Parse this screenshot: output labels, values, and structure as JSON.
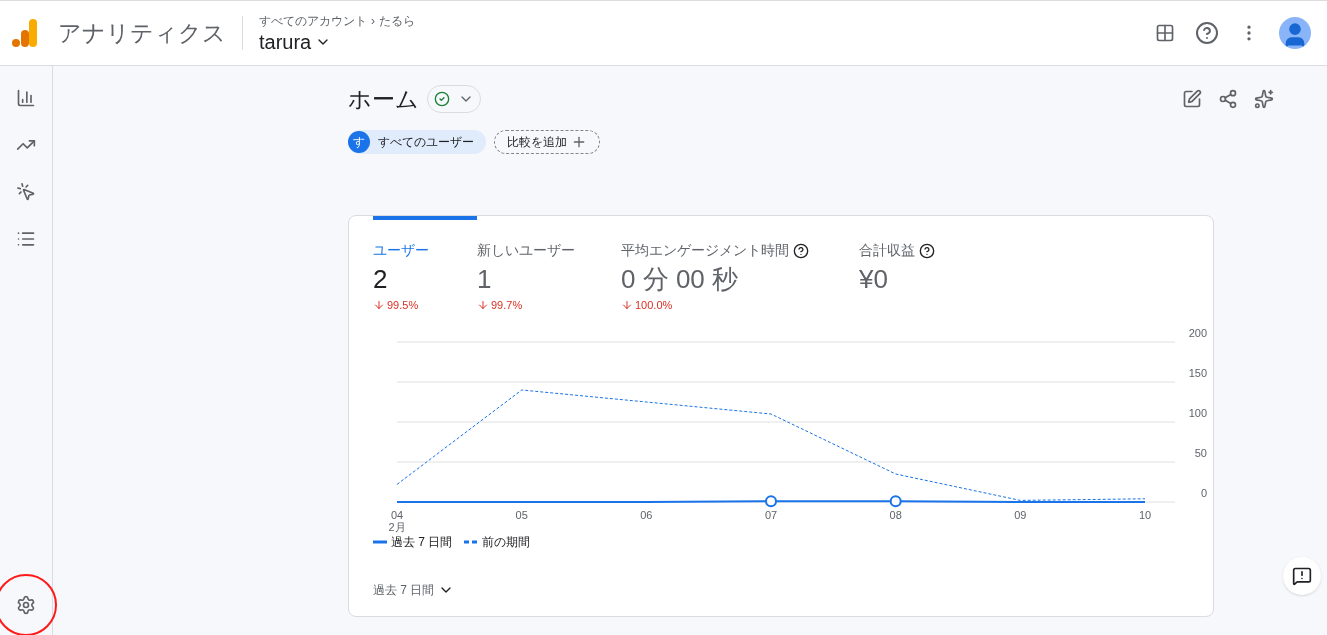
{
  "header": {
    "product": "アナリティクス",
    "breadcrumb": [
      "すべてのアカウント",
      "›",
      "たるら"
    ],
    "property": "tarura"
  },
  "sidebar": {
    "items": [
      {
        "kind": "reports"
      },
      {
        "kind": "explore"
      },
      {
        "kind": "advertising"
      },
      {
        "kind": "configure"
      }
    ],
    "settings_highlighted": true
  },
  "page": {
    "title": "ホーム",
    "verified": true
  },
  "segments": {
    "chip_letter": "す",
    "chip_label": "すべてのユーザー",
    "compare": "比較を追加"
  },
  "card": {
    "metrics": [
      {
        "label": "ユーザー",
        "value": "2",
        "change": "99.5%",
        "selected": true,
        "help": false
      },
      {
        "label": "新しいユーザー",
        "value": "1",
        "change": "99.7%",
        "selected": false,
        "help": false
      },
      {
        "label": "平均エンゲージメント時間",
        "value": "0 分 00 秒",
        "change": "100.0%",
        "selected": false,
        "help": true
      },
      {
        "label": "合計収益",
        "value": "¥0",
        "selected": false,
        "help": true
      }
    ],
    "month_label": "2月",
    "chart_data": {
      "type": "line",
      "grid": true,
      "categories": [
        "04",
        "05",
        "06",
        "07",
        "08",
        "09",
        "10"
      ],
      "ylim": [
        0,
        200
      ],
      "yticks": [
        0,
        50,
        100,
        150,
        200
      ],
      "series": [
        {
          "name": "過去 7 日間",
          "color": "#1a73e8",
          "line_style": "solid",
          "values": [
            0,
            0,
            0,
            1,
            1,
            0,
            0
          ]
        },
        {
          "name": "前の期間",
          "color": "#1a73e8",
          "line_style": "dashed",
          "values": [
            22,
            140,
            125,
            110,
            35,
            2,
            4
          ]
        }
      ]
    },
    "period": "過去 7 日間"
  }
}
